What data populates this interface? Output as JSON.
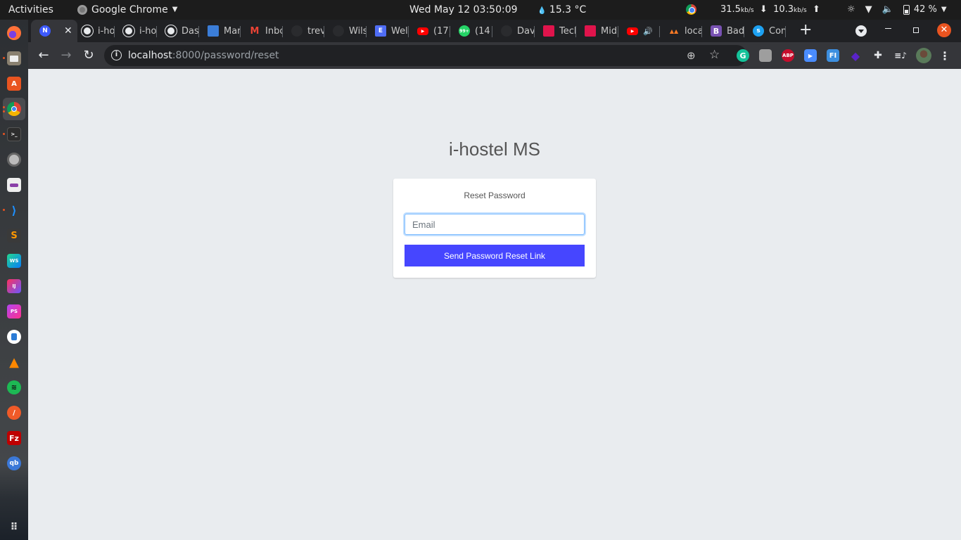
{
  "system_bar": {
    "activities_label": "Activities",
    "app_menu_label": "Google Chrome",
    "clock": "Wed May 12  03:50:09",
    "weather": "15.3 °C",
    "net_down_value": "31.5",
    "net_down_unit": "kb/s",
    "net_up_value": "10.3",
    "net_up_unit": "kb/s",
    "battery": "42 %"
  },
  "dock": {
    "apps": [
      "Firefox",
      "Files",
      "Ubuntu Software",
      "Google Chrome",
      "Terminal",
      "Disk Utility",
      "Tweaks",
      "Visual Studio Code",
      "Sublime Text",
      "WebStorm",
      "IntelliJ IDEA",
      "PhpStorm",
      "App Icon",
      "VLC",
      "Spotify",
      "Web Browser",
      "FileZilla",
      "qBittorrent"
    ],
    "show_apps_label": "Show Applications"
  },
  "browser": {
    "tabs": [
      {
        "title": "",
        "favicon": "N",
        "color": "#3d5afe",
        "active": true
      },
      {
        "title": "i-ho",
        "favicon": "globe"
      },
      {
        "title": "i-ho",
        "favicon": "globe"
      },
      {
        "title": "Dasl",
        "favicon": "globe"
      },
      {
        "title": "Mar",
        "favicon": "app"
      },
      {
        "title": "Inbc",
        "favicon": "M"
      },
      {
        "title": "trev",
        "favicon": "github"
      },
      {
        "title": "Wils",
        "favicon": "github"
      },
      {
        "title": "Wel",
        "favicon": "E"
      },
      {
        "title": "(17)",
        "favicon": "youtube"
      },
      {
        "title": "(14",
        "favicon": "99+"
      },
      {
        "title": "Dav",
        "favicon": "github"
      },
      {
        "title": "Tecl",
        "favicon": "app"
      },
      {
        "title": "Mid",
        "favicon": "app"
      },
      {
        "title": "",
        "favicon": "youtube",
        "audio": true
      },
      {
        "title": "loca",
        "favicon": "xampp"
      },
      {
        "title": "Bad",
        "favicon": "B"
      },
      {
        "title": "Con",
        "favicon": "S"
      }
    ],
    "new_tab_label": "+",
    "url_host": "localhost",
    "url_path": ":8000/password/reset",
    "extensions": [
      "Grammarly",
      "Touch",
      "AdBlock Plus",
      "Zoom",
      "Fonts Ninja",
      "Layers",
      "Extensions",
      "Media",
      "Profile"
    ]
  },
  "page": {
    "brand": "i-hostel MS",
    "card_title": "Reset Password",
    "email_placeholder": "Email",
    "email_value": "",
    "submit_label": "Send Password Reset Link",
    "accent_color": "#4646ff"
  }
}
